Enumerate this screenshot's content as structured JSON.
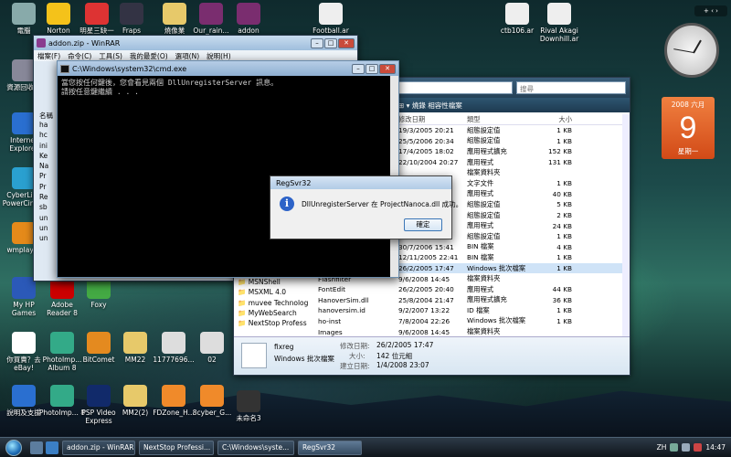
{
  "desktop_icons": [
    {
      "label": "電腦",
      "x": "computer"
    },
    {
      "label": "Norton"
    },
    {
      "label": "明星三缺一"
    },
    {
      "label": "Fraps"
    },
    {
      "label": "燒像業"
    },
    {
      "label": "Our_rain..."
    },
    {
      "label": "addon"
    },
    {
      "label": "Football.ar"
    },
    {
      "label": "ctb106.ar"
    },
    {
      "label": "Rival Akagi Downhill.ar"
    },
    {
      "label": "資源回收筒"
    },
    {
      "label": "Internet Explorer"
    },
    {
      "label": "CyberLink PowerCine..."
    },
    {
      "label": "wmplayer"
    },
    {
      "label": "My HP Games"
    },
    {
      "label": "Adobe Reader 8"
    },
    {
      "label": "Foxy"
    },
    {
      "label": "你買賣？去 eBay!"
    },
    {
      "label": "PhotoImp... Album 8"
    },
    {
      "label": "BitComet"
    },
    {
      "label": "MM22"
    },
    {
      "label": "11777696..."
    },
    {
      "label": "02"
    },
    {
      "label": "說明及支援"
    },
    {
      "label": "PhotoImp... 8"
    },
    {
      "label": "PSP Video Express"
    },
    {
      "label": "MM2(2)"
    },
    {
      "label": "FDZone_H..."
    },
    {
      "label": "8cyber_G..."
    },
    {
      "label": "未命名3"
    }
  ],
  "winrar": {
    "title": "addon.zip - WinRAR",
    "menu": [
      "檔案(F)",
      "命令(C)",
      "工具(S)",
      "我的最愛(O)",
      "選項(N)",
      "說明(H)"
    ],
    "col_header": "名稱",
    "rows": [
      "ha",
      "hc",
      "ini",
      "Ke",
      "Na",
      "Pr",
      "Pr",
      "Re",
      "sb",
      "un",
      "un",
      "un"
    ]
  },
  "cmd": {
    "title": "C:\\Windows\\system32\\cmd.exe",
    "line1": "當您按任何鍵後，您會看見兩個 DllUnregisterServer 訊息。",
    "line2": "請按任意鍵繼續 . . ."
  },
  "explorer": {
    "address": "professional  ▸",
    "search_placeholder": "搜尋",
    "toolbar_text": "⊞ ▾     燒錄  相容性檔案",
    "headers": {
      "date": "修改日期",
      "type": "類型",
      "size": "大小"
    },
    "rows": [
      {
        "name": "",
        "date": "19/3/2005 20:21",
        "type": "組態設定值",
        "size": "1 KB"
      },
      {
        "name": "",
        "date": "25/5/2006 20:34",
        "type": "組態設定值",
        "size": "1 KB"
      },
      {
        "name": "",
        "date": "17/4/2005 18:02",
        "type": "應用程式擴充",
        "size": "152 KB"
      },
      {
        "name": "",
        "date": "22/10/2004 20:27",
        "type": "應用程式",
        "size": "131 KB"
      },
      {
        "name": "",
        "date": "",
        "type": "檔案資料夾",
        "size": ""
      },
      {
        "name": "",
        "date": "",
        "type": "文字文件",
        "size": "1 KB"
      },
      {
        "name": "",
        "date": "",
        "type": "應用程式",
        "size": "40 KB"
      },
      {
        "name": "",
        "date": "",
        "type": "組態設定值",
        "size": "5 KB"
      },
      {
        "name": "",
        "date": "",
        "type": "組態設定值",
        "size": "2 KB"
      },
      {
        "name": "",
        "date": "",
        "type": "應用程式",
        "size": "24 KB"
      },
      {
        "name": "",
        "date": "7/7/2006 17:11",
        "type": "組態設定值",
        "size": "1 KB"
      },
      {
        "name": "",
        "date": "30/7/2006 15:41",
        "type": "BIN 檔案",
        "size": "4 KB"
      },
      {
        "name": "",
        "date": "12/11/2005 22:41",
        "type": "BIN 檔案",
        "size": "1 KB"
      },
      {
        "name": "",
        "date": "26/2/2005 17:47",
        "type": "Windows 批次檔案",
        "size": "1 KB"
      },
      {
        "name": "Flashfilter",
        "date": "9/6/2008 14:45",
        "type": "檔案資料夾",
        "size": ""
      },
      {
        "name": "FontEdit",
        "date": "26/2/2005 20:40",
        "type": "應用程式",
        "size": "44 KB"
      },
      {
        "name": "HanoverSim.dll",
        "date": "25/8/2004 21:47",
        "type": "應用程式擴充",
        "size": "36 KB"
      },
      {
        "name": "hanoversim.id",
        "date": "9/2/2007 13:22",
        "type": "ID 檔案",
        "size": "1 KB"
      },
      {
        "name": "ho-inst",
        "date": "7/8/2004 22:26",
        "type": "Windows 批次檔案",
        "size": "1 KB"
      },
      {
        "name": "Images",
        "date": "9/6/2008 14:45",
        "type": "檔案資料夾",
        "size": ""
      }
    ],
    "nav": [
      "MSN",
      "MSNShell",
      "MSXML 4.0",
      "muvee Technolog",
      "MyWebSearch",
      "NextStop Profess"
    ],
    "details": {
      "name": "fixreg",
      "type": "Windows 批次檔案",
      "modified_label": "修改日期:",
      "modified": "26/2/2005 17:47",
      "size_label": "大小:",
      "size": "142 位元組",
      "created_label": "建立日期:",
      "created": "1/4/2008 23:07"
    }
  },
  "dialog": {
    "title": "RegSvr32",
    "message": "DllUnregisterServer 在 ProjectNanoca.dll 成功。",
    "ok": "確定"
  },
  "calendar": {
    "month": "2008 六月",
    "day": "9",
    "weekday": "星期一"
  },
  "taskbar": {
    "tasks": [
      "addon.zip - WinRAR",
      "NextStop Professi...",
      "C:\\Windows\\syste...",
      "RegSvr32"
    ],
    "lang": "ZH",
    "time": "14:47"
  }
}
